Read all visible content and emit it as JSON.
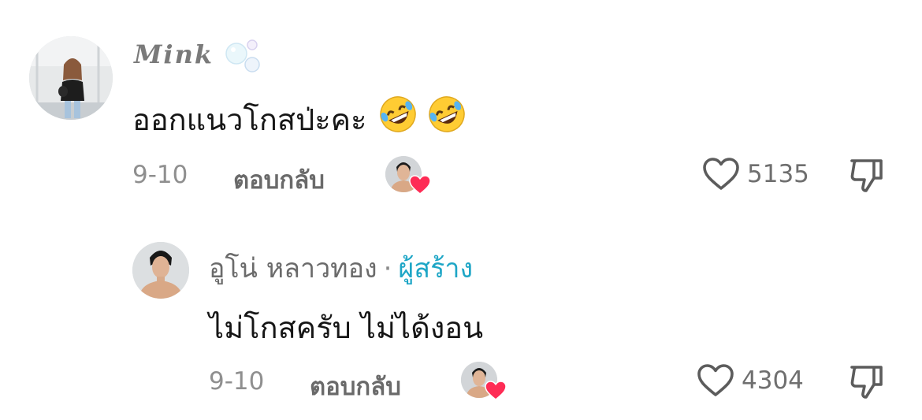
{
  "comments": [
    {
      "username": "Mink",
      "text": "ออกแนวโกสป่ะคะ",
      "emoji": [
        "rolling-on-floor-laughing",
        "rolling-on-floor-laughing"
      ],
      "date": "9-10",
      "reply_label": "ตอบกลับ",
      "likes": "5135"
    },
    {
      "username": "อูโน่ หลาวทอง",
      "creator_badge": "ผู้สร้าง",
      "text": "ไม่โกสครับ ไม่ได้งอน",
      "date": "9-10",
      "reply_label": "ตอบกลับ",
      "likes": "4304"
    }
  ],
  "colors": {
    "creator": "#1ea6c6",
    "liked_heart": "#fe2c55",
    "muted_text": "#8f8f8f"
  },
  "icons": [
    "heart-outline-icon",
    "dislike-icon",
    "bubble-icon",
    "creator-liked-badge"
  ]
}
